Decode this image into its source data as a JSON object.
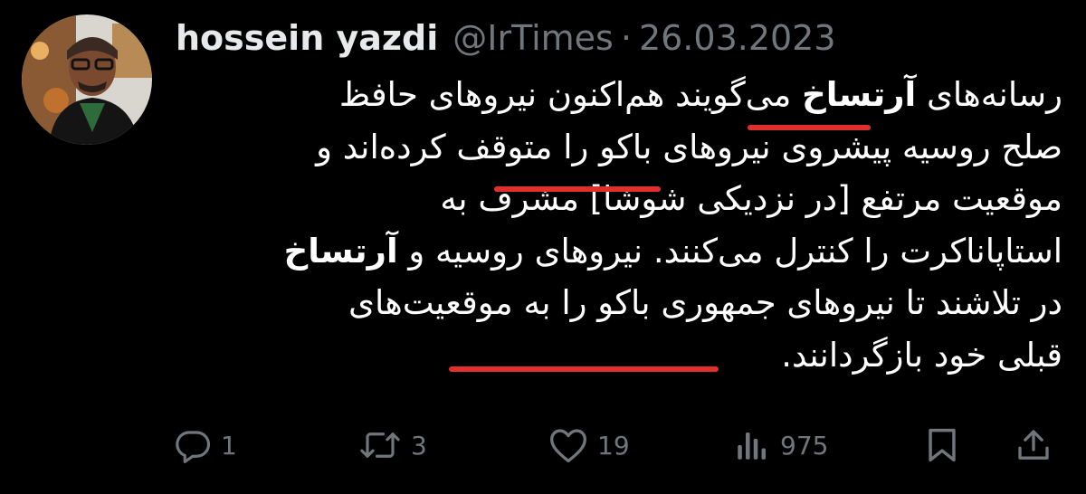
{
  "user": {
    "display_name": "hossein yazdi",
    "handle": "@IrTimes",
    "separator": "·",
    "date": "26.03.2023"
  },
  "body": {
    "lines": [
      [
        "رسانه‌های ",
        "آرتساخ",
        " می‌گویند هم‌اکنون نیروهای حافظ"
      ],
      [
        "صلح روسیه پیشروی نیروهای باکو را متوقف کرده‌اند و"
      ],
      [
        "موقعیت مرتفع [در نزدیکی شوشا] مشرف به"
      ],
      [
        "استاپاناکرت را کنترل می‌کنند. نیروهای روسیه و ",
        "آرتساخ"
      ],
      [
        "در تلاشند تا نیروهای جمهوری باکو را به موقعیت‌های"
      ],
      [
        "قبلی خود بازگردانند."
      ]
    ]
  },
  "actions": {
    "reply": {
      "icon": "reply-icon",
      "count": "1"
    },
    "retweet": {
      "icon": "retweet-icon",
      "count": "3"
    },
    "like": {
      "icon": "heart-icon",
      "count": "19"
    },
    "views": {
      "icon": "views-icon",
      "count": "975"
    },
    "bookmark": {
      "icon": "bookmark-icon"
    },
    "share": {
      "icon": "share-icon"
    }
  },
  "colors": {
    "background": "#000000",
    "text": "#ffffff",
    "muted": "#71767b",
    "underline": "#e0302c"
  }
}
